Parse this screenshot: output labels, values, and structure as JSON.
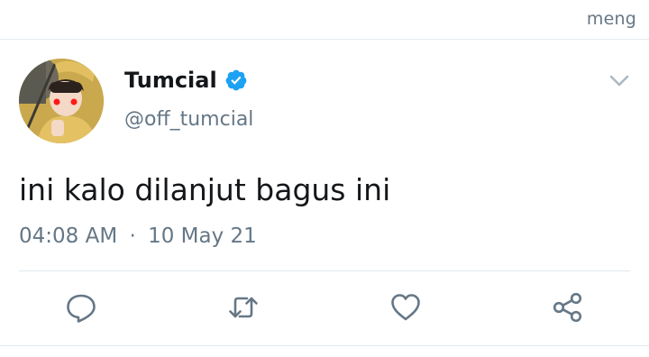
{
  "header": {
    "right_label": "meng"
  },
  "tweet": {
    "display_name": "Tumcial",
    "verified": true,
    "handle": "@off_tumcial",
    "text": "ini kalo dilanjut bagus ini",
    "time": "04:08 AM",
    "separator": "·",
    "date": "10 May 21"
  },
  "actions": {
    "icons": [
      "reply-icon",
      "retweet-icon",
      "like-icon",
      "share-icon"
    ]
  },
  "colors": {
    "secondary_text": "#657786",
    "primary_text": "#14171a",
    "verified_blue": "#1da1f2",
    "divider": "#e1e8ed"
  }
}
